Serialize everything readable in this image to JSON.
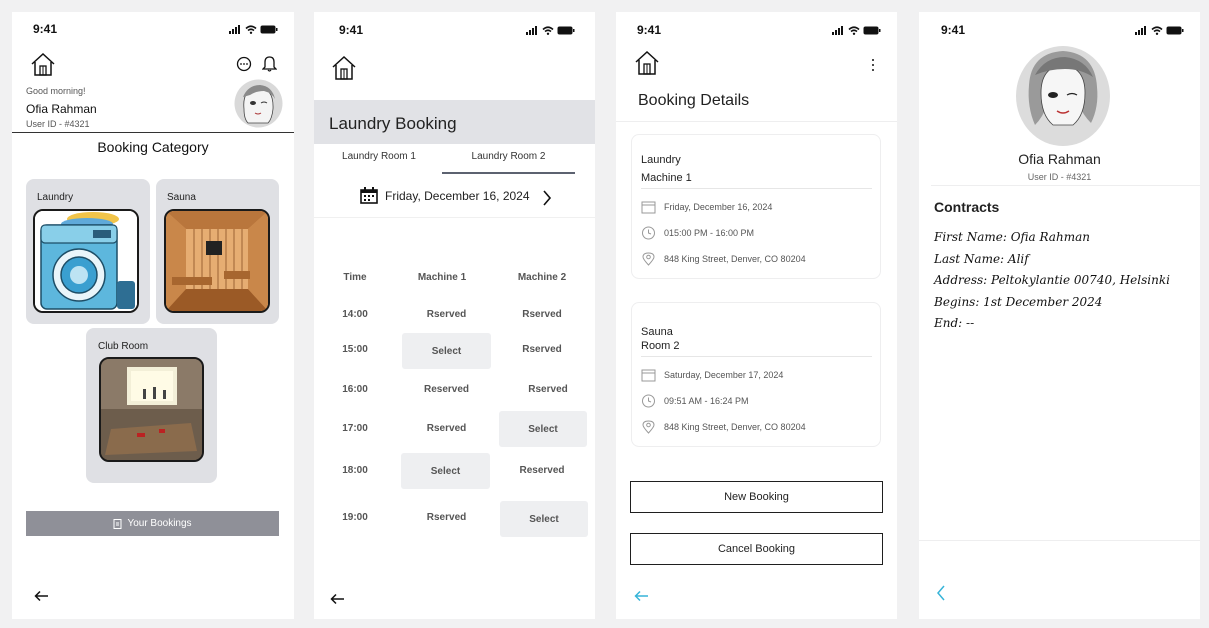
{
  "status_time": "9:41",
  "screen1": {
    "greeting": "Good morning!",
    "user_name": "Ofia Rahman",
    "user_id": "User ID - #4321",
    "title": "Booking Category",
    "categories": [
      {
        "label": "Laundry"
      },
      {
        "label": "Sauna"
      },
      {
        "label": "Club Room"
      }
    ],
    "your_bookings": "Your Bookings"
  },
  "screen2": {
    "title": "Laundry Booking",
    "tabs": [
      {
        "label": "Laundry Room 1",
        "active": false
      },
      {
        "label": "Laundry Room 2",
        "active": true
      }
    ],
    "date": "Friday, December 16, 2024",
    "columns": [
      "Time",
      "Machine 1",
      "Machine 2"
    ],
    "rows": [
      {
        "time": "14:00",
        "m1": "Rserved",
        "m2": "Rserved"
      },
      {
        "time": "15:00",
        "m1": "Select",
        "m2": "Rserved"
      },
      {
        "time": "16:00",
        "m1": "Reserved",
        "m2": "Rserved"
      },
      {
        "time": "17:00",
        "m1": "Rserved",
        "m2": "Select"
      },
      {
        "time": "18:00",
        "m1": "Select",
        "m2": "Reserved"
      },
      {
        "time": "19:00",
        "m1": "Rserved",
        "m2": "Select"
      }
    ]
  },
  "screen3": {
    "title": "Booking Details",
    "bookings": [
      {
        "category": "Laundry",
        "item": "Machine 1",
        "date": "Friday, December 16, 2024",
        "time": "015:00 PM - 16:00 PM",
        "address": "848 King Street, Denver, CO 80204"
      },
      {
        "category": "Sauna",
        "item": "Room 2",
        "date": "Saturday, December 17, 2024",
        "time": "09:51 AM - 16:24 PM",
        "address": "848 King Street, Denver, CO 80204"
      }
    ],
    "new_booking": "New Booking",
    "cancel_booking": "Cancel Booking"
  },
  "screen4": {
    "name": "Ofia Rahman",
    "user_id": "User ID - #4321",
    "section_title": "Contracts",
    "lines": [
      "First Name: Ofia Rahman",
      "Last Name: Alif",
      "Address: Peltokylantie 00740, Helsinki",
      "Begins: 1st December 2024",
      "End: --"
    ]
  },
  "colors": {
    "accent": "#36b4d8",
    "card_gray": "#dfe0e4",
    "button_gray": "#8f9098"
  }
}
